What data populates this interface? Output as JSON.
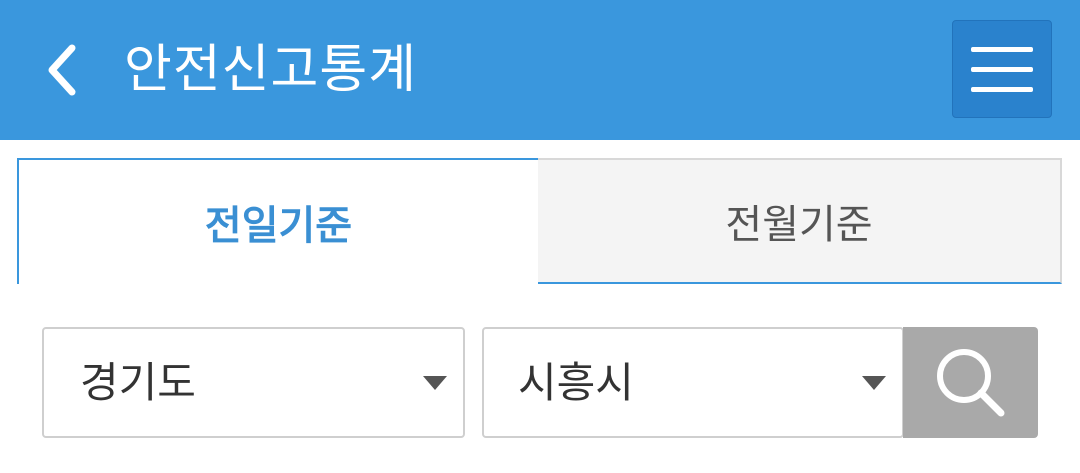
{
  "header": {
    "title": "안전신고통계",
    "back_icon": "chevron-left-icon",
    "menu_icon": "hamburger-menu-icon",
    "background_color": "#3a97dd",
    "menu_button_color": "#2a82cd"
  },
  "tabs": [
    {
      "label": "전일기준",
      "active": true
    },
    {
      "label": "전월기준",
      "active": false
    }
  ],
  "filters": {
    "province": {
      "value": "경기도"
    },
    "city": {
      "value": "시흥시"
    },
    "search_icon": "search-icon",
    "search_button_color": "#a9a9a9"
  }
}
